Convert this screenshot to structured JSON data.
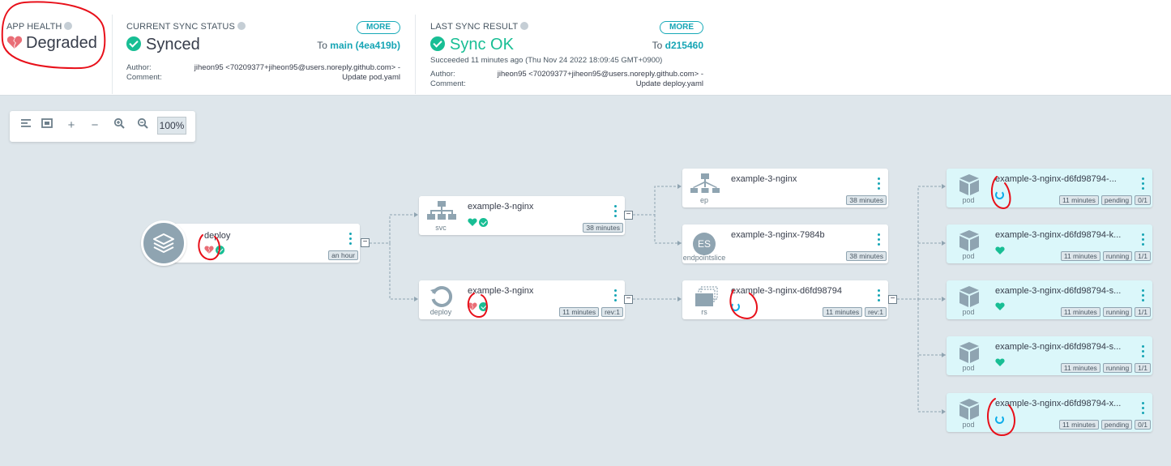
{
  "app_health": {
    "label": "APP HEALTH",
    "status": "Degraded"
  },
  "current_sync": {
    "label": "CURRENT SYNC STATUS",
    "status": "Synced",
    "more": "MORE",
    "to_prefix": "To",
    "revision": "main (4ea419b)",
    "author_label": "Author:",
    "comment_label": "Comment:",
    "author": "jiheon95 <70209377+jiheon95@users.noreply.github.com> -",
    "comment": "Update pod.yaml"
  },
  "last_sync": {
    "label": "LAST SYNC RESULT",
    "status": "Sync OK",
    "more": "MORE",
    "to_prefix": "To",
    "revision": "d215460",
    "succeeded": "Succeeded 11 minutes ago (Thu Nov 24 2022 18:09:45 GMT+0900)",
    "author_label": "Author:",
    "comment_label": "Comment:",
    "author": "jiheon95 <70209377+jiheon95@users.noreply.github.com> -",
    "comment": "Update deploy.yaml"
  },
  "toolbar": {
    "zoom": "100%"
  },
  "nodes": {
    "app": {
      "name": "deploy",
      "tags": [
        "an hour"
      ],
      "health": "degraded",
      "sync": "synced"
    },
    "svc": {
      "name": "example-3-nginx",
      "kind": "svc",
      "tags": [
        "38 minutes"
      ],
      "health": "healthy",
      "sync": "synced"
    },
    "deploy": {
      "name": "example-3-nginx",
      "kind": "deploy",
      "tags": [
        "11 minutes",
        "rev:1"
      ],
      "health": "degraded",
      "sync": "synced"
    },
    "ep": {
      "name": "example-3-nginx",
      "kind": "ep",
      "tags": [
        "38 minutes"
      ]
    },
    "endpointslice": {
      "name": "example-3-nginx-7984b",
      "kind": "endpointslice",
      "badge": "ES",
      "tags": [
        "38 minutes"
      ]
    },
    "rs": {
      "name": "example-3-nginx-d6fd98794",
      "kind": "rs",
      "tags": [
        "11 minutes",
        "rev:1"
      ],
      "health": "progressing"
    },
    "pods": [
      {
        "name": "example-3-nginx-d6fd98794-...",
        "kind": "pod",
        "tags": [
          "11 minutes",
          "pending",
          "0/1"
        ],
        "health": "progressing"
      },
      {
        "name": "example-3-nginx-d6fd98794-k...",
        "kind": "pod",
        "tags": [
          "11 minutes",
          "running",
          "1/1"
        ],
        "health": "healthy"
      },
      {
        "name": "example-3-nginx-d6fd98794-s...",
        "kind": "pod",
        "tags": [
          "11 minutes",
          "running",
          "1/1"
        ],
        "health": "healthy"
      },
      {
        "name": "example-3-nginx-d6fd98794-s...",
        "kind": "pod",
        "tags": [
          "11 minutes",
          "running",
          "1/1"
        ],
        "health": "healthy"
      },
      {
        "name": "example-3-nginx-d6fd98794-x...",
        "kind": "pod",
        "tags": [
          "11 minutes",
          "pending",
          "0/1"
        ],
        "health": "progressing"
      }
    ]
  },
  "colors": {
    "synced": "#18be94",
    "degraded": "#e96d76",
    "accent": "#16a5b5",
    "progressing": "#0dadea",
    "pod_bg": "#dbf7fa",
    "annotation": "#e8101a"
  }
}
